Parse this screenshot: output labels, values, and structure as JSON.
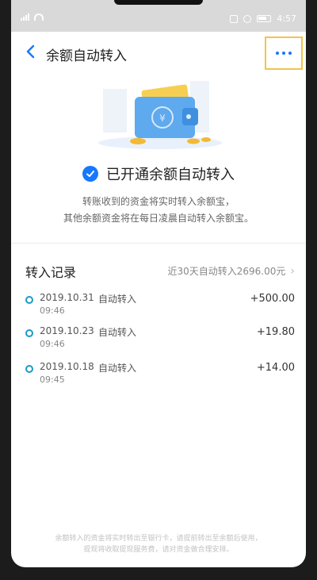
{
  "statusbar": {
    "time": "4:57"
  },
  "header": {
    "title": "余额自动转入"
  },
  "status": {
    "text": "已开通余额自动转入",
    "desc_line1": "转账收到的资金将实时转入余额宝，",
    "desc_line2": "其他余额资金将在每日凌晨自动转入余额宝。"
  },
  "records": {
    "title": "转入记录",
    "summary": "近30天自动转入2696.00元",
    "items": [
      {
        "date": "2019.10.31",
        "type": "自动转入",
        "time": "09:46",
        "amount": "+500.00"
      },
      {
        "date": "2019.10.23",
        "type": "自动转入",
        "time": "09:46",
        "amount": "+19.80"
      },
      {
        "date": "2019.10.18",
        "type": "自动转入",
        "time": "09:45",
        "amount": "+14.00"
      }
    ]
  },
  "footer": {
    "line1": "余额转入的资金将实时转出至银行卡，请提前转出至余额后使用，",
    "line2": "提现将收取提现服务费，请对资金做合理安排。"
  },
  "colors": {
    "accent": "#1677ff",
    "dot": "#1a9ac7",
    "highlight": "#f3c34a"
  }
}
